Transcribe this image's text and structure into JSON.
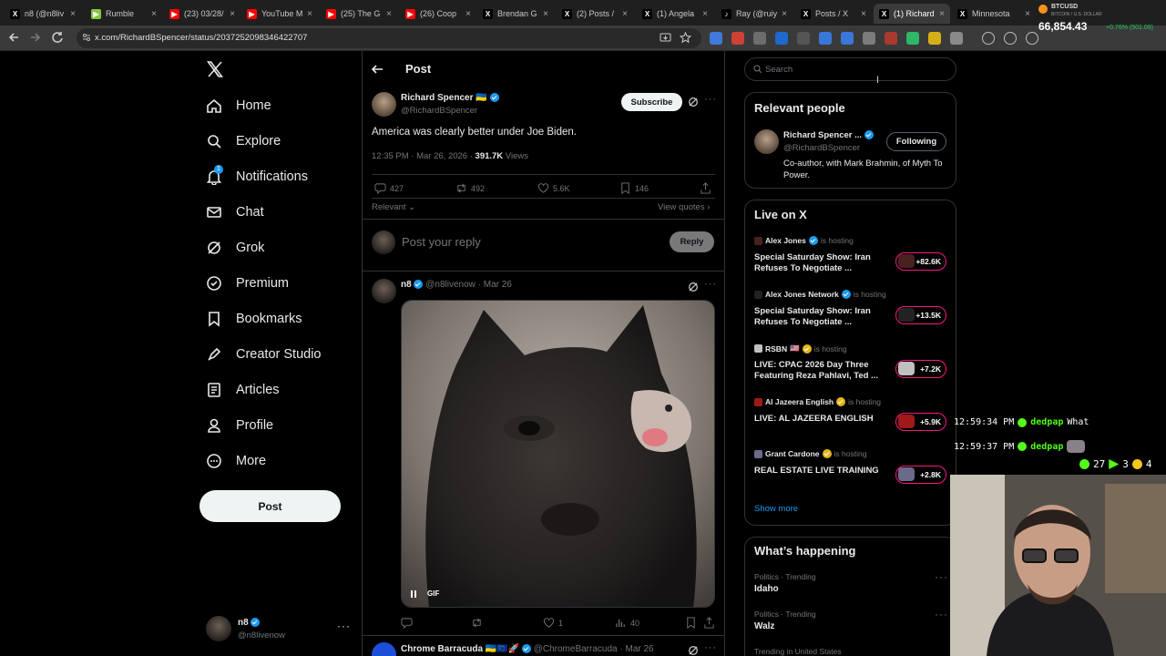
{
  "browser": {
    "tabs": [
      {
        "title": "n8 (@n8liv",
        "color": "#000000",
        "icon": "x-logo"
      },
      {
        "title": "Rumble",
        "color": "#85c742",
        "icon": "rumble-logo"
      },
      {
        "title": "(23) 03/28/",
        "color": "#ff0000",
        "icon": "youtube-logo"
      },
      {
        "title": "YouTube M",
        "color": "#ff0000",
        "icon": "youtube-logo"
      },
      {
        "title": "(25) The G",
        "color": "#ff0000",
        "icon": "youtube-logo"
      },
      {
        "title": "(26) Coop",
        "color": "#ff0000",
        "icon": "youtube-logo"
      },
      {
        "title": "Brendan G",
        "color": "#000000",
        "icon": "x-logo"
      },
      {
        "title": "(2) Posts /",
        "color": "#000000",
        "icon": "x-logo"
      },
      {
        "title": "(1) Angela",
        "color": "#000000",
        "icon": "x-logo"
      },
      {
        "title": "Ray (@ruiy",
        "color": "#000000",
        "icon": "tiktok-logo"
      },
      {
        "title": "Posts / X",
        "color": "#000000",
        "icon": "x-logo"
      },
      {
        "title": "(1) Richard",
        "color": "#000000",
        "icon": "x-logo",
        "active": true
      },
      {
        "title": "Minnesota",
        "color": "#000000",
        "icon": "x-logo"
      }
    ],
    "url": "x.com/RichardBSpencer/status/2037252098346422707",
    "btc": {
      "label": "BTCUSD",
      "sub": "BITCOIN / U.S. DOLLAR",
      "price": "66,854.43",
      "change": "+0.76% (501.09)"
    }
  },
  "nav": {
    "items": [
      {
        "label": "Home",
        "icon": "home-icon"
      },
      {
        "label": "Explore",
        "icon": "search-icon"
      },
      {
        "label": "Notifications",
        "icon": "bell-icon",
        "badge": "1"
      },
      {
        "label": "Chat",
        "icon": "mail-icon"
      },
      {
        "label": "Grok",
        "icon": "grok-icon"
      },
      {
        "label": "Premium",
        "icon": "premium-icon"
      },
      {
        "label": "Bookmarks",
        "icon": "bookmark-icon"
      },
      {
        "label": "Creator Studio",
        "icon": "rocket-icon"
      },
      {
        "label": "Articles",
        "icon": "article-icon"
      },
      {
        "label": "Profile",
        "icon": "person-icon"
      },
      {
        "label": "More",
        "icon": "more-circle-icon"
      }
    ],
    "post_button": "Post",
    "account": {
      "name": "n8",
      "handle": "@n8livenow"
    }
  },
  "header": {
    "title": "Post"
  },
  "post": {
    "author": "Richard Spencer",
    "flag": "🇺🇦",
    "handle": "@RichardBSpencer",
    "subscribe_label": "Subscribe",
    "text": "America was clearly better under Joe Biden.",
    "time": "12:35 PM · Mar 26, 2026 · ",
    "views_count": "391.7K",
    "views_label": " Views",
    "replies": "427",
    "reposts": "492",
    "likes": "5.6K",
    "bookmarks": "146",
    "sort_label": "Relevant",
    "view_quotes": "View quotes"
  },
  "composer": {
    "placeholder": "Post your reply",
    "button": "Reply"
  },
  "reply1": {
    "name": "n8",
    "handle": "@n8livenow",
    "date": "· Mar 26",
    "gif_label": "GIF",
    "replies": "",
    "reposts": "",
    "likes": "1",
    "views": "40"
  },
  "reply2": {
    "name": "Chrome Barracuda",
    "flags": "🇺🇦🇪🇺🚀",
    "handle": "@ChromeBarracuda",
    "date": "· Mar 26"
  },
  "search": {
    "placeholder": "Search"
  },
  "relevant": {
    "title": "Relevant people",
    "name": "Richard Spencer ...",
    "handle": "@RichardBSpencer",
    "follow_label": "Following",
    "bio": "Co-author, with Mark Brahmin, of Myth To Power."
  },
  "live": {
    "title": "Live on X",
    "hosting_label": "is hosting",
    "items": [
      {
        "host": "Alex Jones",
        "flag": "",
        "title": "Special Saturday Show: Iran Refuses To Negotiate ...",
        "count": "+82.6K",
        "verify": "blue"
      },
      {
        "host": "Alex Jones Network",
        "flag": "",
        "title": "Special Saturday Show: Iran Refuses To Negotiate ...",
        "count": "+13.5K",
        "verify": "blue"
      },
      {
        "host": "RSBN",
        "flag": "🇺🇸",
        "title": "LIVE: CPAC 2026 Day Three Featuring Reza Pahlavi, Ted ...",
        "count": "+7.2K",
        "verify": "gold"
      },
      {
        "host": "Al Jazeera English",
        "flag": "",
        "title": "LIVE: AL JAZEERA ENGLISH",
        "count": "+5.9K",
        "verify": "gold"
      },
      {
        "host": "Grant Cardone",
        "flag": "",
        "title": "REAL ESTATE LIVE TRAINING",
        "count": "+2.8K",
        "verify": "gold"
      }
    ],
    "show_more": "Show more"
  },
  "happening": {
    "title": "What’s happening",
    "items": [
      {
        "category": "Politics · Trending",
        "name": "Idaho"
      },
      {
        "category": "Politics · Trending",
        "name": "Walz"
      },
      {
        "category": "Trending in United States",
        "name": ""
      }
    ]
  },
  "stream": {
    "chat": [
      {
        "time": "12:59:34 PM",
        "user": "dedpap",
        "msg": "What"
      },
      {
        "time": "12:59:37 PM",
        "user": "dedpap",
        "msg": ""
      }
    ],
    "stats": {
      "viewers": "27",
      "streams": "3",
      "emotes": "4"
    }
  }
}
